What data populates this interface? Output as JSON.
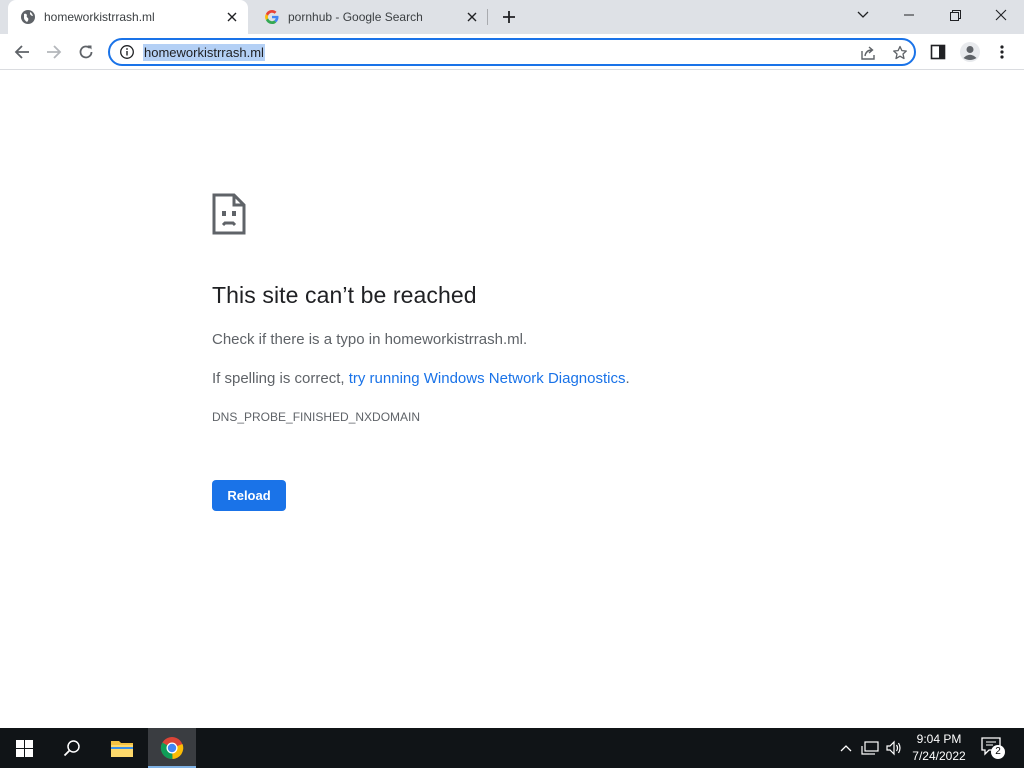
{
  "browser": {
    "tabs": [
      {
        "title": "homeworkistrrash.ml",
        "active": true,
        "favicon": "globe-icon"
      },
      {
        "title": "pornhub - Google Search",
        "active": false,
        "favicon": "google-g-icon"
      }
    ],
    "address_bar": {
      "url": "homeworkistrrash.ml",
      "icon": "info-icon"
    }
  },
  "error_page": {
    "title": "This site can’t be reached",
    "line1": "Check if there is a typo in homeworkistrrash.ml.",
    "line2_prefix": "If spelling is correct, ",
    "line2_link": "try running Windows Network Diagnostics",
    "line2_suffix": ".",
    "error_code": "DNS_PROBE_FINISHED_NXDOMAIN",
    "reload_label": "Reload"
  },
  "taskbar": {
    "time": "9:04 PM",
    "date": "7/24/2022",
    "notification_count": "2"
  },
  "colors": {
    "accent": "#1a73e8",
    "tabstrip": "#dee1e6",
    "taskbar": "#101417",
    "url_selection": "#b4d0f5"
  }
}
